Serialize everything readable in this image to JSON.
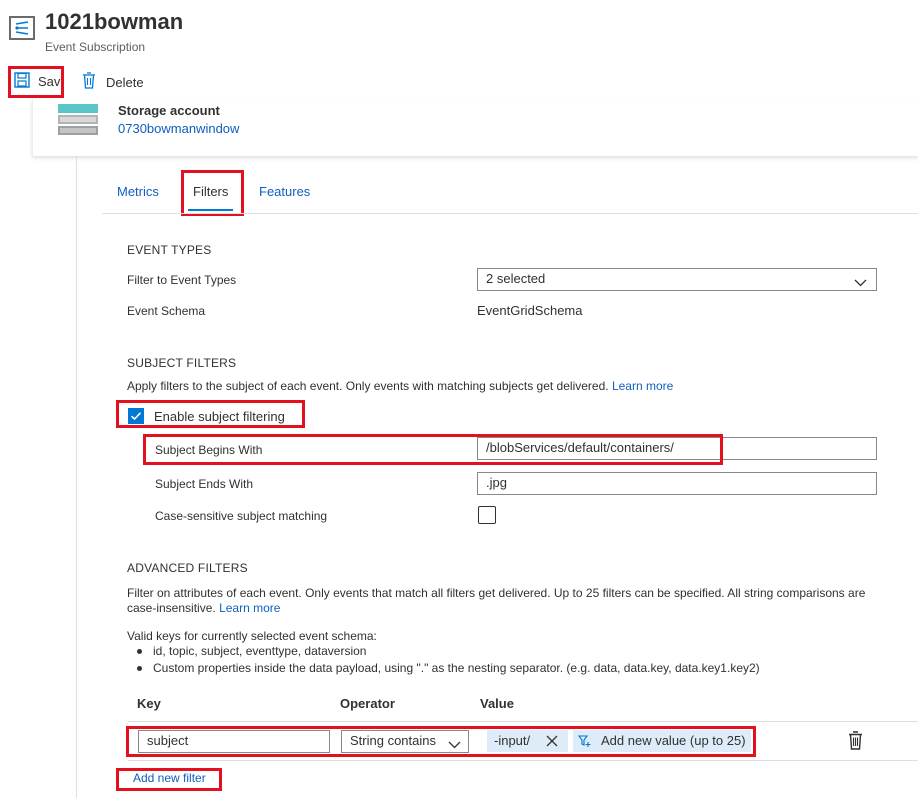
{
  "header": {
    "title": "1021bowman",
    "subtitle": "Event Subscription"
  },
  "toolbar": {
    "save_label": "Save",
    "delete_label": "Delete"
  },
  "topic": {
    "type_label": "Storage account",
    "name": "0730bowmanwindow"
  },
  "tabs": [
    "Metrics",
    "Filters",
    "Features"
  ],
  "event_types": {
    "heading": "EVENT TYPES",
    "filter_label": "Filter to Event Types",
    "filter_value": "2 selected",
    "schema_label": "Event Schema",
    "schema_value": "EventGridSchema"
  },
  "subject_filters": {
    "heading": "SUBJECT FILTERS",
    "description": "Apply filters to the subject of each event. Only events with matching subjects get delivered.",
    "learn_more": "Learn more",
    "enable_label": "Enable subject filtering",
    "enabled": true,
    "begins_label": "Subject Begins With",
    "begins_value": "/blobServices/default/containers/",
    "ends_label": "Subject Ends With",
    "ends_value": ".jpg",
    "case_label": "Case-sensitive subject matching"
  },
  "advanced_filters": {
    "heading": "ADVANCED FILTERS",
    "description": "Filter on attributes of each event. Only events that match all filters get delivered. Up to 25 filters can be specified. All string comparisons are",
    "description2": "case-insensitive.",
    "learn_more": "Learn more",
    "valid_keys_intro": "Valid keys for currently selected event schema:",
    "bullet1": "id, topic, subject, eventtype, dataversion",
    "bullet2": "Custom properties inside the data payload, using \".\" as the nesting separator. (e.g. data, data.key, data.key1.key2)",
    "col_key": "Key",
    "col_operator": "Operator",
    "col_value": "Value",
    "row": {
      "key": "subject",
      "operator": "String contains",
      "value_tag": "-input/",
      "add_value": "Add new value (up to 25)"
    },
    "add_filter": "Add new filter"
  }
}
